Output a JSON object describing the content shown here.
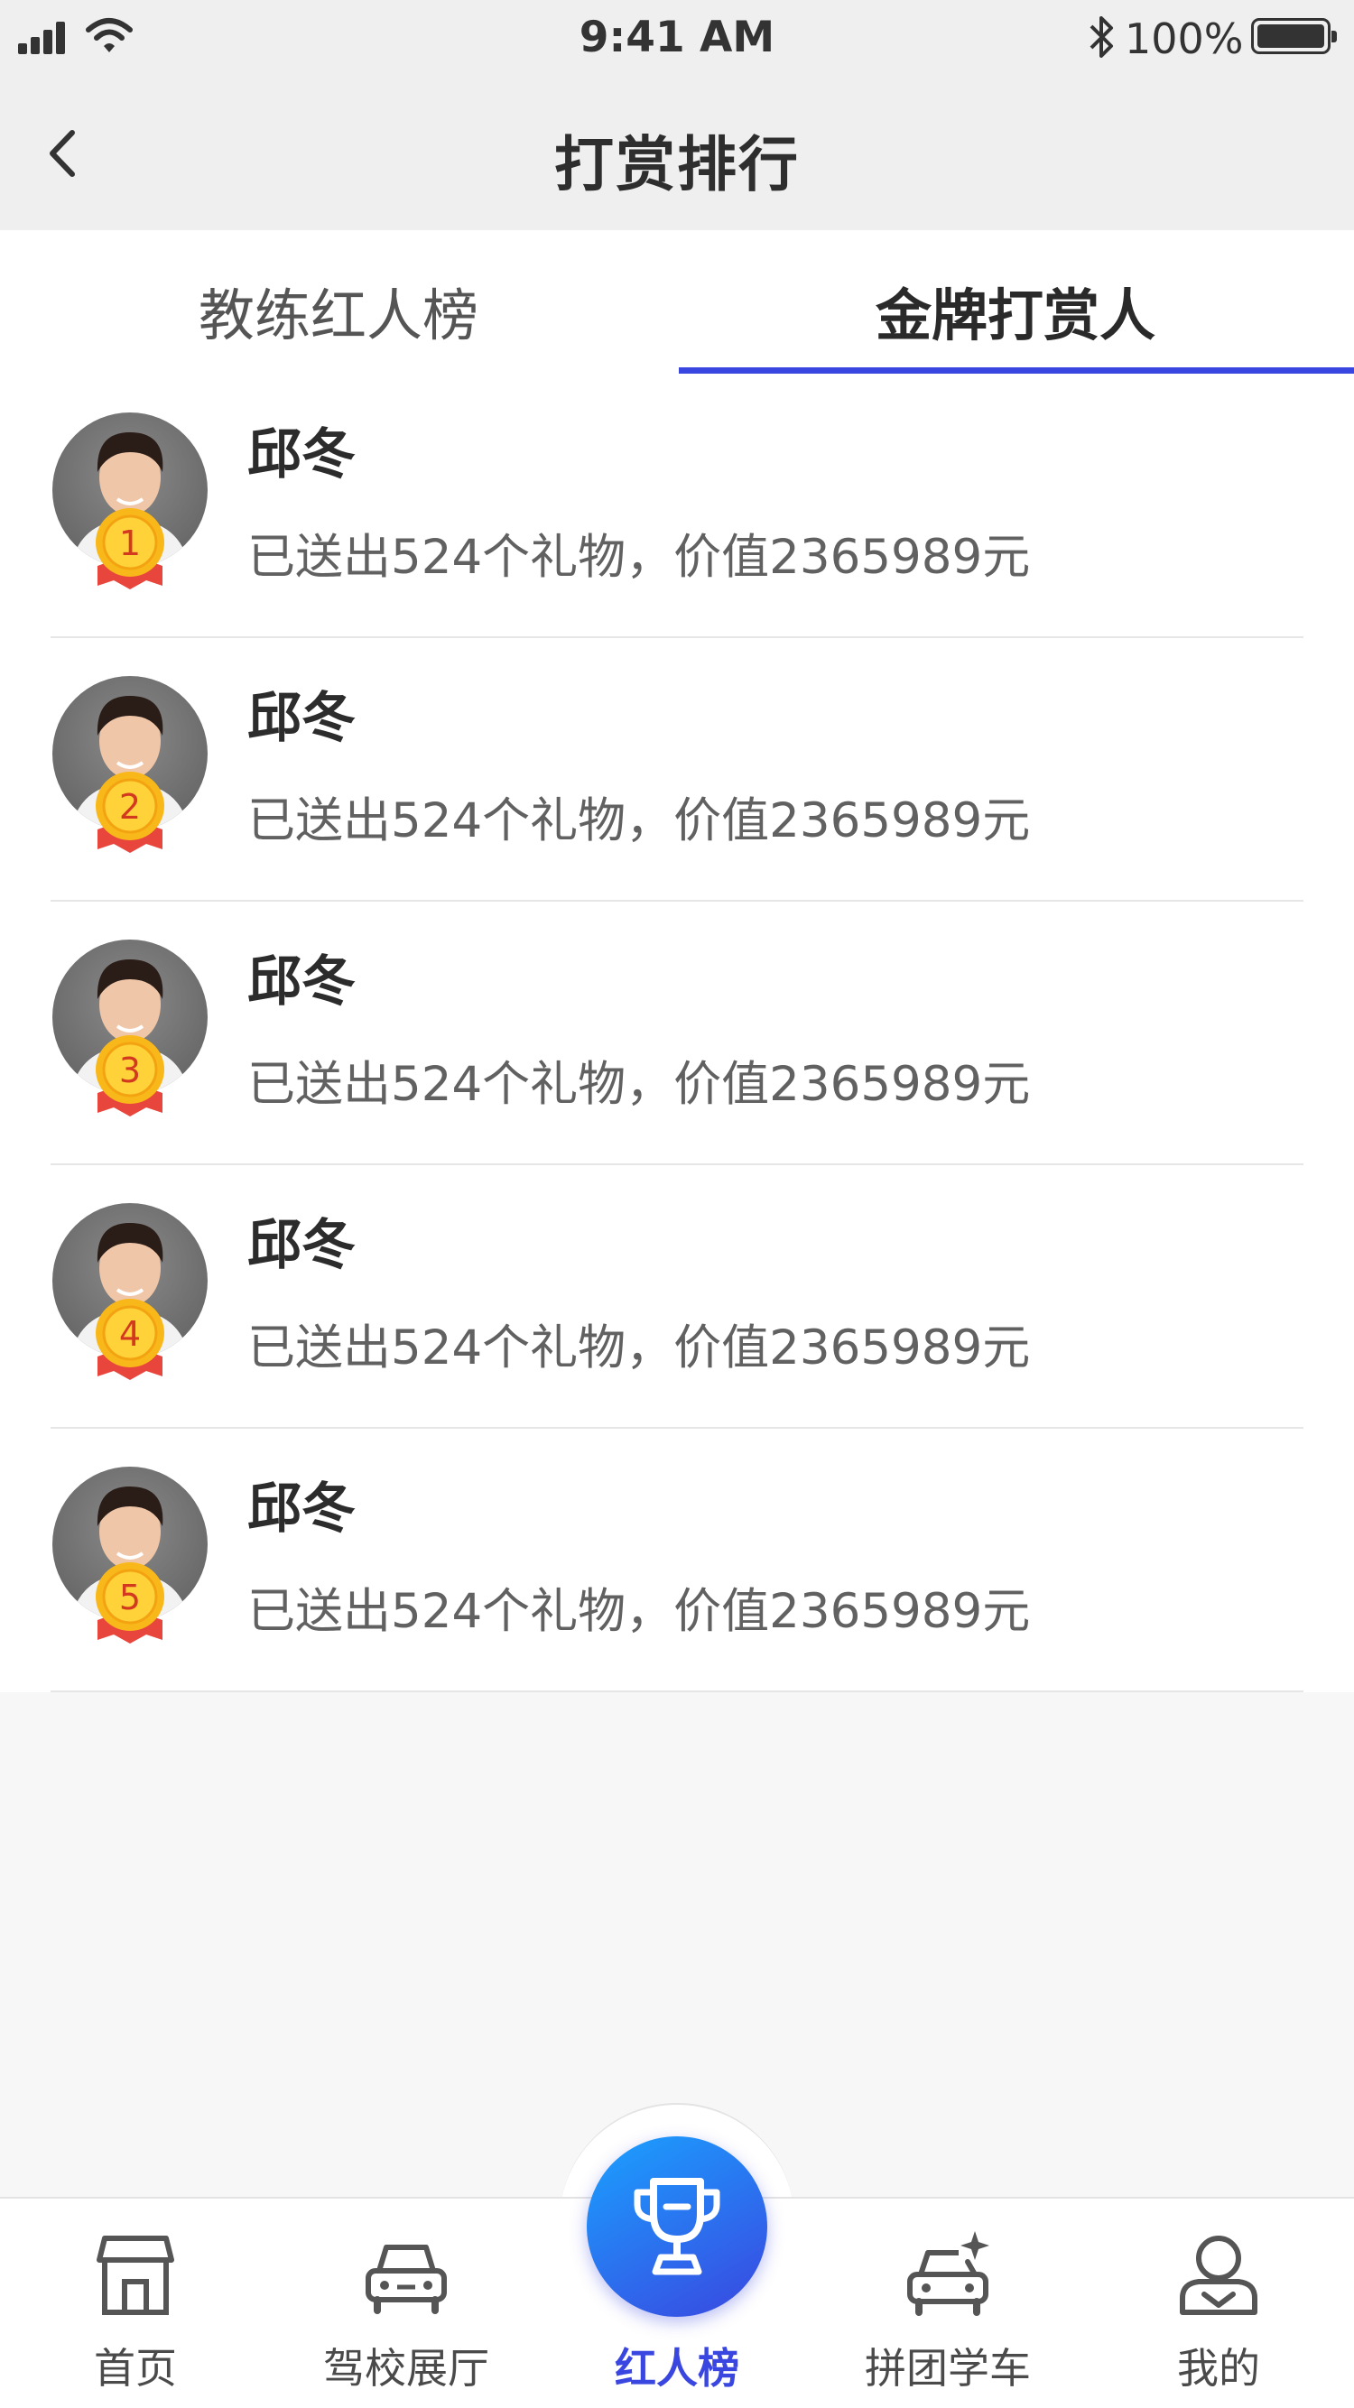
{
  "status_bar": {
    "time": "9:41 AM",
    "battery": "100%",
    "icons": [
      "signal-icon",
      "wifi-icon",
      "bluetooth-icon",
      "battery-icon"
    ]
  },
  "nav": {
    "title": "打赏排行",
    "back_icon": "chevron-left-icon"
  },
  "tabs": {
    "items": [
      {
        "label": "教练红人榜",
        "active": false
      },
      {
        "label": "金牌打赏人",
        "active": true
      }
    ]
  },
  "list": {
    "rows": [
      {
        "rank": "1",
        "name": "邱冬",
        "desc": "已送出524个礼物，价值2365989元"
      },
      {
        "rank": "2",
        "name": "邱冬",
        "desc": "已送出524个礼物，价值2365989元"
      },
      {
        "rank": "3",
        "name": "邱冬",
        "desc": "已送出524个礼物，价值2365989元"
      },
      {
        "rank": "4",
        "name": "邱冬",
        "desc": "已送出524个礼物，价值2365989元"
      },
      {
        "rank": "5",
        "name": "邱冬",
        "desc": "已送出524个礼物，价值2365989元"
      }
    ]
  },
  "tabbar": {
    "items": [
      {
        "label": "首页",
        "icon": "store-icon",
        "active": false
      },
      {
        "label": "驾校展厅",
        "icon": "car-icon",
        "active": false
      },
      {
        "label": "红人榜",
        "icon": "trophy-icon",
        "active": true
      },
      {
        "label": "拼团学车",
        "icon": "car-sparkle-icon",
        "active": false
      },
      {
        "label": "我的",
        "icon": "user-icon",
        "active": false
      }
    ]
  },
  "colors": {
    "accent": "#3a46e0",
    "medal_gold": "#f9b81a",
    "ribbon_red": "#e8453c"
  }
}
